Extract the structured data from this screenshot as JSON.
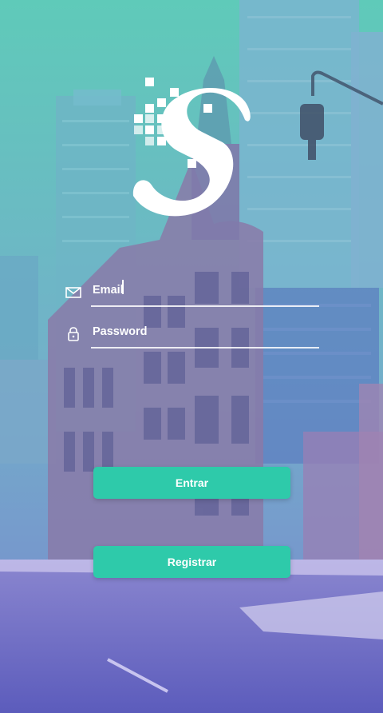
{
  "app": {
    "logo_name": "S"
  },
  "login": {
    "email_placeholder": "Email",
    "password_placeholder": "Password",
    "email_icon": "envelope-icon",
    "password_icon": "lock-icon"
  },
  "actions": {
    "login_label": "Entrar",
    "register_label": "Registrar"
  },
  "colors": {
    "primary_button": "#2ecaaa",
    "overlay_top": "#57c7b8",
    "overlay_bottom": "#6a6cc4",
    "text": "#ffffff"
  }
}
